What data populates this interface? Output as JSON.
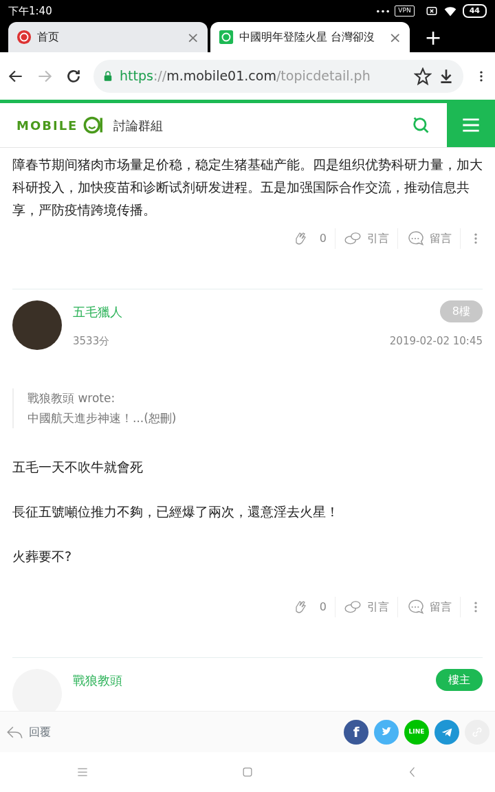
{
  "status_bar": {
    "time": "下午1:40",
    "vpn": "VPN",
    "battery": "44"
  },
  "tabs": [
    {
      "label": "首页",
      "selected": false,
      "close": "×"
    },
    {
      "label": "中國明年登陸火星 台灣卻沒",
      "selected": true,
      "close": "×"
    }
  ],
  "new_tab": "+",
  "address_bar": {
    "scheme": "https",
    "sep": "://",
    "host": "m.mobile01.com",
    "path": "/topicdetail.ph",
    "secure": true
  },
  "site_header": {
    "logo": "MOBILE",
    "section": "討論群組"
  },
  "intro_text": "障春节期间猪肉市场量足价稳，稳定生猪基础产能。四是组织优势科研力量，加大科研投入，加快疫苗和诊断试剂研发进程。五是加强国际合作交流，推动信息共享，严防疫情跨境传播。",
  "actions_1": {
    "likes": "0",
    "quote": "引言",
    "comment": "留言"
  },
  "posts": [
    {
      "author": "五毛獵人",
      "score": "3533分",
      "floor": "8樓",
      "op": false,
      "date": "2019-02-02 10:45",
      "quote": {
        "author": "戰狼教頭 wrote:",
        "text": "中國航天進步神速！...(恕刪)"
      },
      "paragraphs": [
        "五毛一天不吹牛就會死",
        "長征五號噸位推力不夠，已經爆了兩次，還意淫去火星！",
        "火葬要不?"
      ],
      "actions": {
        "likes": "0",
        "quote": "引言",
        "comment": "留言"
      }
    },
    {
      "author": "戰狼教頭",
      "floor": "樓主",
      "op": true
    }
  ],
  "reply_bar": {
    "reply": "回覆",
    "share": [
      {
        "kind": "facebook",
        "label": "f",
        "color": "#3b5998"
      },
      {
        "kind": "twitter",
        "color": "#4ab3f4"
      },
      {
        "kind": "line",
        "label": "LINE",
        "color": "#00c300"
      },
      {
        "kind": "telegram",
        "color": "#1e96d4"
      },
      {
        "kind": "link",
        "color": "#eeeeee"
      }
    ]
  }
}
